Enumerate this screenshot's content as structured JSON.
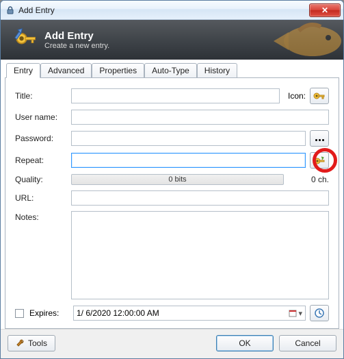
{
  "window": {
    "title": "Add Entry"
  },
  "banner": {
    "title": "Add Entry",
    "subtitle": "Create a new entry."
  },
  "tabs": {
    "entry": "Entry",
    "advanced": "Advanced",
    "properties": "Properties",
    "autotype": "Auto-Type",
    "history": "History"
  },
  "fields": {
    "title_label": "Title:",
    "title_value": "",
    "icon_label": "Icon:",
    "username_label": "User name:",
    "username_value": "",
    "password_label": "Password:",
    "password_value": "",
    "repeat_label": "Repeat:",
    "repeat_value": "",
    "quality_label": "Quality:",
    "quality_value": "0 bits",
    "chars_value": "0 ch.",
    "url_label": "URL:",
    "url_value": "",
    "notes_label": "Notes:",
    "notes_value": "",
    "expires_label": "Expires:",
    "expires_value": "1/ 6/2020 12:00:00 AM"
  },
  "footer": {
    "tools": "Tools",
    "ok": "OK",
    "cancel": "Cancel"
  },
  "icons": {
    "lock": "lock-icon",
    "key": "key-icon",
    "close": "close-icon",
    "dots": "hide-password-icon",
    "keygen": "generate-password-icon",
    "clock": "clock-icon",
    "calendar": "calendar-icon",
    "wrench": "tools-icon"
  }
}
